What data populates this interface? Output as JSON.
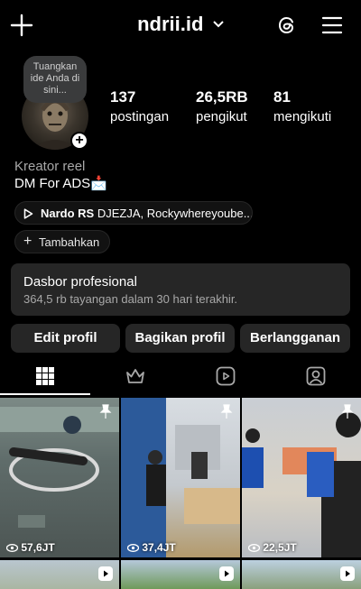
{
  "header": {
    "username": "ndrii.id"
  },
  "profile": {
    "note": "Tuangkan ide Anda di sini...",
    "stats": [
      {
        "value": "137",
        "label": "postingan"
      },
      {
        "value": "26,5RB",
        "label": "pengikut"
      },
      {
        "value": "81",
        "label": "mengikuti"
      }
    ],
    "category": "Kreator reel",
    "bio": "DM For ADS📩",
    "music_artist": "Nardo RS",
    "music_title": "DJEZJA, Rockywhereyoube...",
    "add_label": "Tambahkan"
  },
  "dashboard": {
    "title": "Dasbor profesional",
    "subtitle": "364,5 rb tayangan dalam 30 hari terakhir."
  },
  "actions": {
    "edit": "Edit profil",
    "share": "Bagikan profil",
    "subscribe": "Berlangganan"
  },
  "tabs": [
    "grid-icon",
    "crown-icon",
    "reels-icon",
    "tagged-icon"
  ],
  "posts": [
    {
      "views": "57,6JT",
      "pinned": true
    },
    {
      "views": "37,4JT",
      "pinned": true
    },
    {
      "views": "22,5JT",
      "pinned": true
    }
  ]
}
